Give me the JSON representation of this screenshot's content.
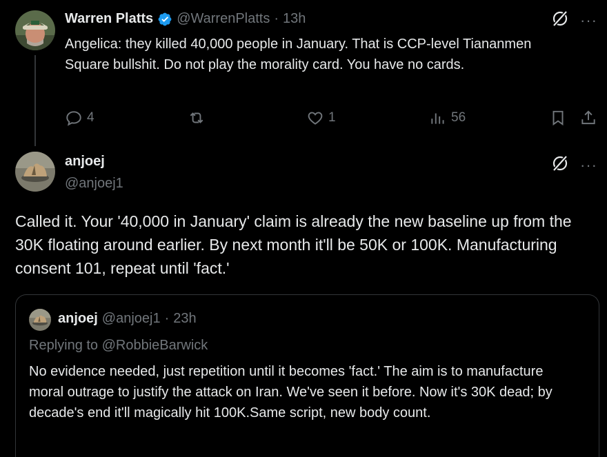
{
  "tweet1": {
    "author_name": "Warren Platts",
    "handle": "@WarrenPlatts",
    "separator": "·",
    "time": "13h",
    "body": "Angelica: they killed 40,000 people in January. That is CCP-level Tiananmen Square bullshit. Do not play the morality card. You have no cards.",
    "replies": "4",
    "likes": "1",
    "views": "56",
    "more_label": "···"
  },
  "tweet2": {
    "author_name": "anjoej",
    "handle": "@anjoej1",
    "body": "Called it. Your '40,000 in January' claim is already the new baseline up from the 30K floating around earlier. By next month it'll be 50K or 100K. Manufacturing consent 101, repeat until 'fact.'",
    "more_label": "···"
  },
  "quote": {
    "author_name": "anjoej",
    "handle": "@anjoej1",
    "separator": "·",
    "time": "23h",
    "replying_to": "Replying to @RobbieBarwick",
    "body": "No evidence needed, just repetition until it becomes 'fact.' The aim is to manufacture moral outrage to justify the attack on Iran. We've seen it before. Now it's 30K dead; by decade's end it'll magically hit 100K.Same script, new body count."
  },
  "colors": {
    "background": "#000000",
    "text": "#e7e9ea",
    "muted": "#71767b",
    "verified": "#1d9bf0",
    "border": "#333639"
  },
  "icons": [
    "verified-badge-icon",
    "grok-icon",
    "more-icon",
    "reply-icon",
    "repost-icon",
    "like-icon",
    "views-icon",
    "bookmark-icon",
    "share-icon"
  ]
}
